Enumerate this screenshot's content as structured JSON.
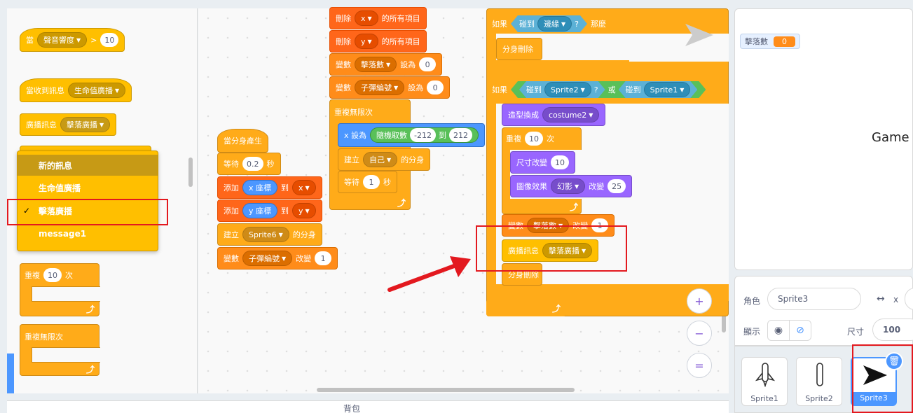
{
  "palette": {
    "when_hat": {
      "label": "當",
      "sensor": "聲音響度",
      "op": ">",
      "value": "10"
    },
    "receive_hat": {
      "label": "當收到訊息",
      "message": "生命值廣播"
    },
    "broadcast": {
      "label": "廣播訊息",
      "message": "擊落廣播"
    },
    "dropdown_menu": [
      "新的訊息",
      "生命值廣播",
      "擊落廣播",
      "message1"
    ],
    "selected_check": "✓",
    "repeat": {
      "label": "重複",
      "value": "10",
      "suffix": "次"
    },
    "forever": {
      "label": "重複無限次"
    }
  },
  "script1": {
    "hat": "當分身產生",
    "wait": {
      "label": "等待",
      "value": "0.2",
      "suffix": "秒"
    },
    "add1": {
      "label": "添加",
      "reporter": "x 座標",
      "to": "到",
      "list": "x"
    },
    "add2": {
      "label": "添加",
      "reporter": "y 座標",
      "to": "到",
      "list": "y"
    },
    "create": {
      "label": "建立",
      "target": "Sprite6",
      "suffix": "的分身"
    },
    "change": {
      "label": "變數",
      "var": "子彈編號",
      "mid": "改變",
      "value": "1"
    }
  },
  "script2": {
    "del_x": {
      "label": "刪除",
      "list": "x",
      "suffix": "的所有項目"
    },
    "del_y": {
      "label": "刪除",
      "list": "y",
      "suffix": "的所有項目"
    },
    "set1": {
      "label": "變數",
      "var": "擊落數",
      "mid": "設為",
      "value": "0"
    },
    "set2": {
      "label": "變數",
      "var": "子彈編號",
      "mid": "設為",
      "value": "0"
    },
    "forever": "重複無限次",
    "setx": {
      "label": "x 設為",
      "op": "隨機取數",
      "from": "-212",
      "to_word": "到",
      "to": "212"
    },
    "create": {
      "label": "建立",
      "target": "自己",
      "suffix": "的分身"
    },
    "wait": {
      "label": "等待",
      "value": "1",
      "suffix": "秒"
    }
  },
  "script3": {
    "if1": {
      "label": "如果",
      "touch": "碰到",
      "target": "邊緣",
      "q": "?",
      "then": "那麼"
    },
    "del_clone1": "分身刪除",
    "if2": {
      "label": "如果",
      "touch1": "碰到",
      "target1": "Sprite2",
      "q": "?",
      "or": "或",
      "touch2": "碰到",
      "target2": "Sprite1"
    },
    "costume": {
      "label": "造型換成",
      "value": "costume2"
    },
    "repeat": {
      "label": "重複",
      "value": "10",
      "suffix": "次"
    },
    "size": {
      "label": "尺寸改變",
      "value": "10"
    },
    "effect": {
      "label": "圖像效果",
      "effect": "幻影",
      "mid": "改變",
      "value": "25"
    },
    "change": {
      "label": "變數",
      "var": "擊落數",
      "mid": "改變",
      "value": "1"
    },
    "broadcast": {
      "label": "廣播訊息",
      "message": "擊落廣播"
    },
    "del_clone2": "分身刪除"
  },
  "zoom": {
    "in": "+",
    "out": "−",
    "reset": "="
  },
  "stage": {
    "monitor_label": "擊落數",
    "monitor_value": "0",
    "game_text": "Game"
  },
  "sprite_info": {
    "sprite_label": "角色",
    "sprite_name": "Sprite3",
    "x_label": "x",
    "show_label": "顯示",
    "size_label": "尺寸",
    "size_value": "100"
  },
  "sprites": [
    {
      "name": "Sprite1",
      "icon": "rocket-icon"
    },
    {
      "name": "Sprite2",
      "icon": "bullet-icon"
    },
    {
      "name": "Sprite3",
      "icon": "paper-plane-icon"
    }
  ],
  "bottom_bar": {
    "label": "背包"
  },
  "colors": {
    "event": "#ffbf00",
    "control": "#ffab19",
    "variable": "#ff8c1a",
    "list": "#ff661a",
    "motion": "#4c97ff",
    "looks": "#9966ff",
    "sensing": "#5cb1d6",
    "operator": "#59c059",
    "annotation": "#e3191f"
  }
}
